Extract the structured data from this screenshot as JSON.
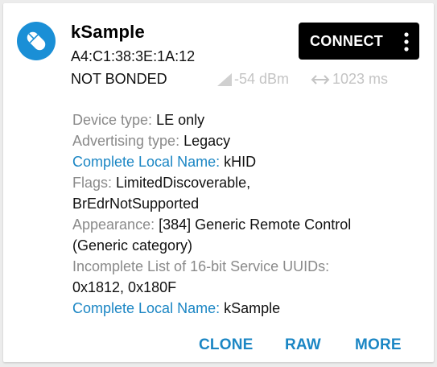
{
  "device": {
    "name": "kSample",
    "address": "A4:C1:38:3E:1A:12",
    "bond_state": "NOT BONDED",
    "rssi": "-54 dBm",
    "interval": "1023 ms",
    "icon": "remote-control-icon"
  },
  "buttons": {
    "connect": "CONNECT",
    "clone": "CLONE",
    "raw": "RAW",
    "more": "MORE"
  },
  "details": {
    "device_type_label": "Device type:",
    "device_type_value": "LE only",
    "advertising_type_label": "Advertising type:",
    "advertising_type_value": "Legacy",
    "complete_local_name_1_label": "Complete Local Name:",
    "complete_local_name_1_value": "kHID",
    "flags_label": "Flags:",
    "flags_value_line1": "LimitedDiscoverable,",
    "flags_value_line2": "BrEdrNotSupported",
    "appearance_label": "Appearance:",
    "appearance_value_line1": "[384] Generic Remote Control",
    "appearance_value_line2": "(Generic category)",
    "uuids_label": "Incomplete List of 16-bit Service UUIDs:",
    "uuids_value": "0x1812, 0x180F",
    "complete_local_name_2_label": "Complete Local Name:",
    "complete_local_name_2_value": "kSample"
  },
  "colors": {
    "accent_blue": "#1b86c4",
    "avatar_blue": "#1a8fd6",
    "label_gray": "#8a8a8a",
    "disabled_gray": "#c4c4c4",
    "connect_bg": "#000000"
  }
}
